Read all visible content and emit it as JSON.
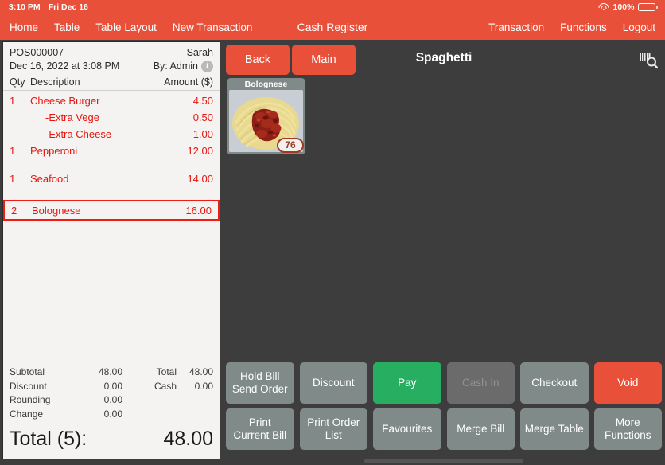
{
  "statusbar": {
    "time": "3:10 PM",
    "date": "Fri Dec 16",
    "wifi_icon": "wifi-icon",
    "battery_percent": "100%",
    "battery_icon": "battery-icon"
  },
  "navbar": {
    "title": "Cash Register",
    "left_items": [
      {
        "label": "Home",
        "name": "nav-item-home"
      },
      {
        "label": "Table",
        "name": "nav-item-table"
      },
      {
        "label": "Table Layout",
        "name": "nav-item-table-layout"
      },
      {
        "label": "New Transaction",
        "name": "nav-item-new-transaction"
      }
    ],
    "right_items": [
      {
        "label": "Transaction",
        "name": "nav-item-transaction"
      },
      {
        "label": "Functions",
        "name": "nav-item-functions"
      },
      {
        "label": "Logout",
        "name": "nav-item-logout"
      }
    ]
  },
  "receipt": {
    "order_id": "POS000007",
    "customer": "Sarah",
    "datetime": "Dec 16, 2022 at 3:08 PM",
    "operator": "By: Admin",
    "info_icon": "info-icon",
    "columns": {
      "qty": "Qty",
      "description": "Description",
      "amount": "Amount ($)"
    },
    "items": [
      {
        "qty": "1",
        "description": "Cheese Burger",
        "amount": "4.50",
        "type": "item",
        "selected": false
      },
      {
        "qty": "",
        "description": "-Extra Vege",
        "amount": "0.50",
        "type": "modifier",
        "selected": false
      },
      {
        "qty": "",
        "description": "-Extra Cheese",
        "amount": "1.00",
        "type": "modifier",
        "selected": false
      },
      {
        "qty": "1",
        "description": "Pepperoni",
        "amount": "12.00",
        "type": "item",
        "selected": false
      },
      {
        "qty": "1",
        "description": "Seafood",
        "amount": "14.00",
        "type": "item",
        "selected": false
      },
      {
        "qty": "2",
        "description": "Bolognese",
        "amount": "16.00",
        "type": "item",
        "selected": true
      }
    ],
    "summary": {
      "subtotal_label": "Subtotal",
      "subtotal_value": "48.00",
      "discount_label": "Discount",
      "discount_value": "0.00",
      "rounding_label": "Rounding",
      "rounding_value": "0.00",
      "change_label": "Change",
      "change_value": "0.00",
      "total_label": "Total",
      "total_value": "48.00",
      "cash_label": "Cash",
      "cash_value": "0.00"
    },
    "grand_total_label": "Total (5):",
    "grand_total_value": "48.00"
  },
  "menu": {
    "back_label": "Back",
    "main_label": "Main",
    "category_title": "Spaghetti",
    "scan_icon": "barcode-scan-icon",
    "products": [
      {
        "name": "Bolognese",
        "quantity_badge": "76",
        "image": "spaghetti-bolognese-photo"
      }
    ]
  },
  "actions": {
    "row1": [
      {
        "label": "Hold Bill\nSend Order",
        "name": "hold-bill-send-order-button",
        "style": "default",
        "disabled": false
      },
      {
        "label": "Discount",
        "name": "discount-button",
        "style": "default",
        "disabled": false
      },
      {
        "label": "Pay",
        "name": "pay-button",
        "style": "pay",
        "disabled": false
      },
      {
        "label": "Cash In",
        "name": "cash-in-button",
        "style": "disabled",
        "disabled": true
      },
      {
        "label": "Checkout",
        "name": "checkout-button",
        "style": "default",
        "disabled": false
      },
      {
        "label": "Void",
        "name": "void-button",
        "style": "void",
        "disabled": false
      }
    ],
    "row2": [
      {
        "label": "Print\nCurrent Bill",
        "name": "print-current-bill-button",
        "style": "default",
        "disabled": false
      },
      {
        "label": "Print Order\nList",
        "name": "print-order-list-button",
        "style": "default",
        "disabled": false
      },
      {
        "label": "Favourites",
        "name": "favourites-button",
        "style": "default",
        "disabled": false
      },
      {
        "label": "Merge Bill",
        "name": "merge-bill-button",
        "style": "default",
        "disabled": false
      },
      {
        "label": "Merge Table",
        "name": "merge-table-button",
        "style": "default",
        "disabled": false
      },
      {
        "label": "More\nFunctions",
        "name": "more-functions-button",
        "style": "default",
        "disabled": false
      }
    ]
  },
  "colors": {
    "brand_red": "#e8503a",
    "selected_red": "#ee1c11",
    "item_text_red": "#e8160f",
    "pay_green": "#27ae60",
    "panel_dark": "#3d3d3d",
    "button_gray": "#7f8a89",
    "receipt_paper": "#f4f3f1"
  }
}
